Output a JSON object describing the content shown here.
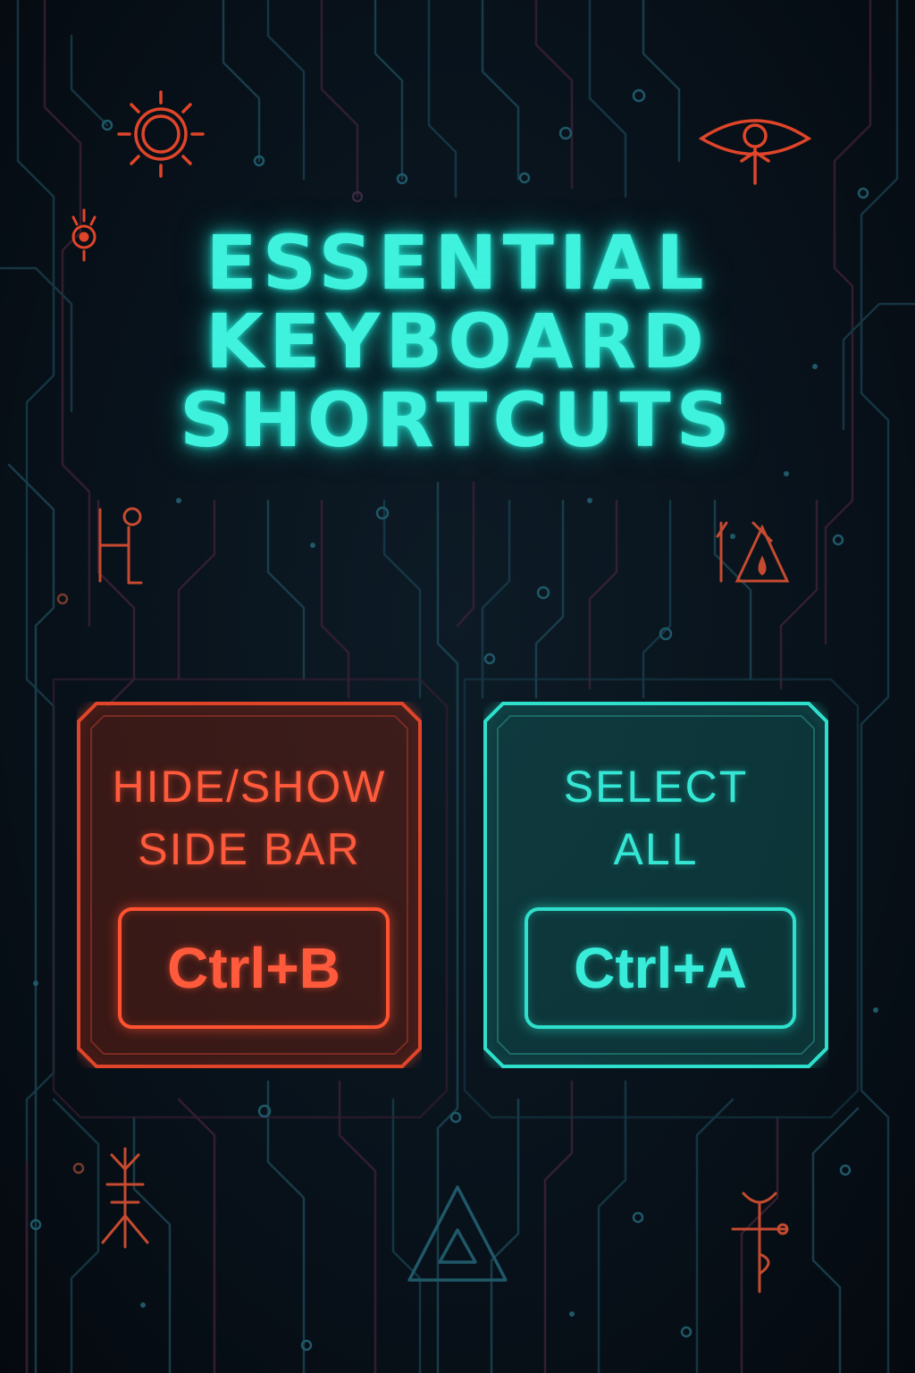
{
  "poster": {
    "title_lines": [
      "ESSENTIAL",
      "KEYBOARD",
      "SHORTCUTS"
    ],
    "accent_cyan": "#3ff2de",
    "accent_orange": "#ff5230",
    "background": "#08121b"
  },
  "shortcuts": [
    {
      "label_lines": [
        "HIDE/SHOW",
        "SIDE BAR"
      ],
      "key": "Ctrl+B",
      "color": "#ff5230"
    },
    {
      "label_lines": [
        "SELECT",
        "ALL"
      ],
      "key": "Ctrl+A",
      "color": "#2ee0cc"
    }
  ],
  "decorations": {
    "icons": [
      "sun-glyph-icon",
      "eye-glyph-icon",
      "small-sun-glyph-icon",
      "h-rune-icon",
      "tent-rune-icon",
      "branch-rune-icon",
      "triangle-glyph-icon",
      "ankh-rune-icon"
    ]
  }
}
